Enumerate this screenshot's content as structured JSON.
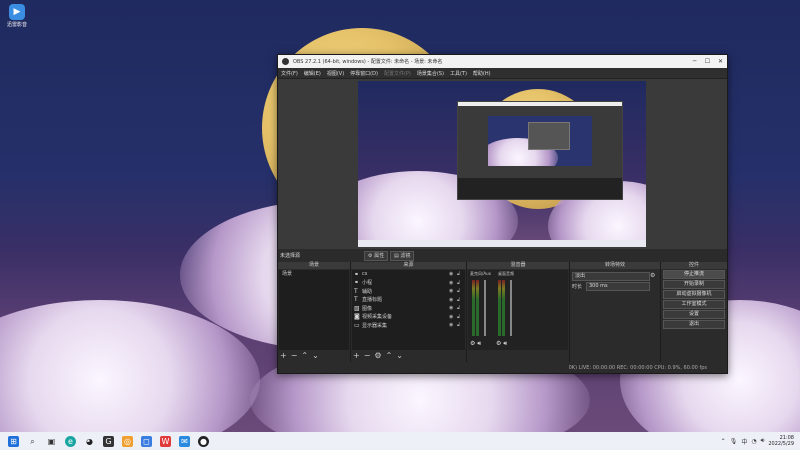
{
  "desktop": {
    "icon_label": "迅雷影音"
  },
  "window": {
    "title": "OBS 27.2.1 (64-bit, windows) - 配置文件: 未命名 - 场景: 未命名",
    "menu": [
      "文件(F)",
      "编辑(E)",
      "视图(V)",
      "停靠窗口(D)",
      "配置文件(P)",
      "场景集合(S)",
      "工具(T)",
      "帮助(H)"
    ]
  },
  "scene_bar": {
    "label": "未选择源",
    "props_label": "属性",
    "filters_label": "滤镜"
  },
  "docks": {
    "scenes": {
      "title": "场景",
      "items": [
        "场景"
      ]
    },
    "sources": {
      "title": "来源",
      "items": [
        {
          "label": "cs",
          "icon": "link-icon"
        },
        {
          "label": "小程",
          "icon": "link-icon"
        },
        {
          "label": "辅助",
          "icon": "text-icon"
        },
        {
          "label": "直播标题",
          "icon": "text-icon"
        },
        {
          "label": "图像",
          "icon": "image-icon"
        },
        {
          "label": "视频采集设备",
          "icon": "camera-icon"
        },
        {
          "label": "显示器采集",
          "icon": "monitor-icon"
        }
      ]
    },
    "mixer": {
      "title": "混音器",
      "ch1": "麦克风/Aux",
      "ch2": "桌面音频"
    },
    "transitions": {
      "title": "转场特效",
      "selected": "淡出",
      "duration_label": "时长",
      "duration_value": "300 ms"
    },
    "controls": {
      "title": "控件",
      "buttons": [
        "停止推流",
        "开始录制",
        "启动虚拟摄像机",
        "工作室模式",
        "设置",
        "退出"
      ]
    }
  },
  "statusbar": {
    "text": "0K) LIVE: 00:00:00   REC: 00:00:00   CPU: 0.9%, 60.00 fps"
  },
  "taskbar": {
    "time": "21:08",
    "date": "2022/5/29"
  }
}
